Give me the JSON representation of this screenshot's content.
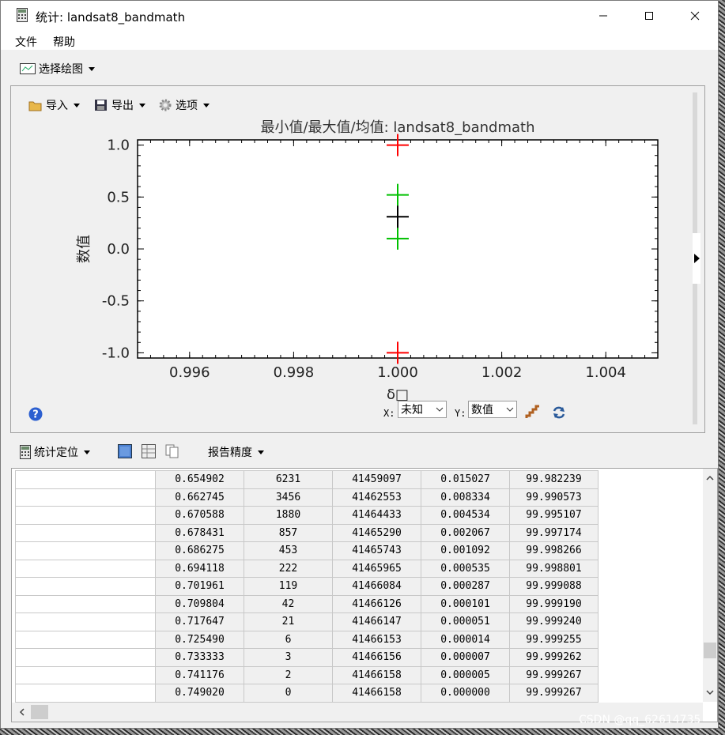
{
  "window": {
    "title": "统计: landsat8_bandmath",
    "menu": [
      "文件",
      "帮助"
    ]
  },
  "toolbar": {
    "select_plot": "选择绘图",
    "import": "导入",
    "export": "导出",
    "options": "选项"
  },
  "chart_data": {
    "type": "scatter",
    "title": "最小值/最大值/均值: landsat8_bandmath",
    "xlabel": "δ□",
    "ylabel": "数值",
    "xlim": [
      0.995,
      1.005
    ],
    "ylim": [
      -1.05,
      1.05
    ],
    "x_ticks": [
      "0.996",
      "0.998",
      "1.000",
      "1.002",
      "1.004"
    ],
    "y_ticks": [
      "1.0",
      "0.5",
      "0.0",
      "-0.5",
      "-1.0"
    ],
    "grid": false,
    "marker": "plus",
    "series": [
      {
        "color": "#ff0000",
        "points": [
          [
            1.0,
            1.0
          ],
          [
            1.0,
            -1.0
          ]
        ]
      },
      {
        "color": "#00c000",
        "points": [
          [
            1.0,
            0.52
          ],
          [
            1.0,
            0.1
          ]
        ]
      },
      {
        "color": "#000000",
        "points": [
          [
            1.0,
            0.31
          ]
        ]
      }
    ]
  },
  "axis_selectors": {
    "x_label": "X:",
    "x_value": "未知",
    "y_label": "Y:",
    "y_value": "数值"
  },
  "stats_toolbar": {
    "stat_locate": "统计定位",
    "report_precision": "报告精度"
  },
  "table": {
    "rows": [
      [
        "",
        "0.654902",
        "6231",
        "41459097",
        "0.015027",
        "99.982239"
      ],
      [
        "",
        "0.662745",
        "3456",
        "41462553",
        "0.008334",
        "99.990573"
      ],
      [
        "",
        "0.670588",
        "1880",
        "41464433",
        "0.004534",
        "99.995107"
      ],
      [
        "",
        "0.678431",
        "857",
        "41465290",
        "0.002067",
        "99.997174"
      ],
      [
        "",
        "0.686275",
        "453",
        "41465743",
        "0.001092",
        "99.998266"
      ],
      [
        "",
        "0.694118",
        "222",
        "41465965",
        "0.000535",
        "99.998801"
      ],
      [
        "",
        "0.701961",
        "119",
        "41466084",
        "0.000287",
        "99.999088"
      ],
      [
        "",
        "0.709804",
        "42",
        "41466126",
        "0.000101",
        "99.999190"
      ],
      [
        "",
        "0.717647",
        "21",
        "41466147",
        "0.000051",
        "99.999240"
      ],
      [
        "",
        "0.725490",
        "6",
        "41466153",
        "0.000014",
        "99.999255"
      ],
      [
        "",
        "0.733333",
        "3",
        "41466156",
        "0.000007",
        "99.999262"
      ],
      [
        "",
        "0.741176",
        "2",
        "41466158",
        "0.000005",
        "99.999267"
      ],
      [
        "",
        "0.749020",
        "0",
        "41466158",
        "0.000000",
        "99.999267"
      ]
    ]
  },
  "watermark": "CSDN @qq_62614735",
  "colors": {
    "plot_red": "#ff0000",
    "plot_green": "#00c000",
    "plot_black": "#000000"
  }
}
